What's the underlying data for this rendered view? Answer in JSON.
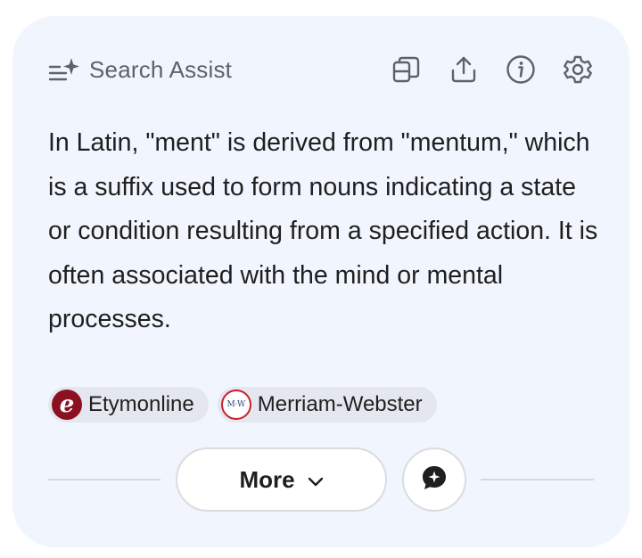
{
  "header": {
    "title": "Search Assist",
    "title_icon": "sparkle-list-icon",
    "tools": [
      {
        "name": "copy-button",
        "icon": "copy-icon"
      },
      {
        "name": "share-button",
        "icon": "share-icon"
      },
      {
        "name": "info-button",
        "icon": "info-icon"
      },
      {
        "name": "settings-button",
        "icon": "gear-icon"
      }
    ]
  },
  "answer": {
    "text": "In Latin, \"ment\" is derived from \"mentum,\" which is a suffix used to form nouns indicating a state or condition resulting from a specified action. It is often associated with the mind or mental processes."
  },
  "sources": [
    {
      "label": "Etymonline",
      "logo_text": "e",
      "logo_color": "#8b1020"
    },
    {
      "label": "Merriam-Webster",
      "logo_text": "M·W",
      "logo_color": "#c81f2d"
    }
  ],
  "footer": {
    "more_label": "More",
    "more_icon": "chevron-down-icon",
    "chat_icon": "sparkle-chat-icon"
  },
  "colors": {
    "card_background": "#f1f5fd",
    "chip_background": "#e4e7ef",
    "muted_text": "#5f6368",
    "body_text": "#1f1f1f"
  }
}
